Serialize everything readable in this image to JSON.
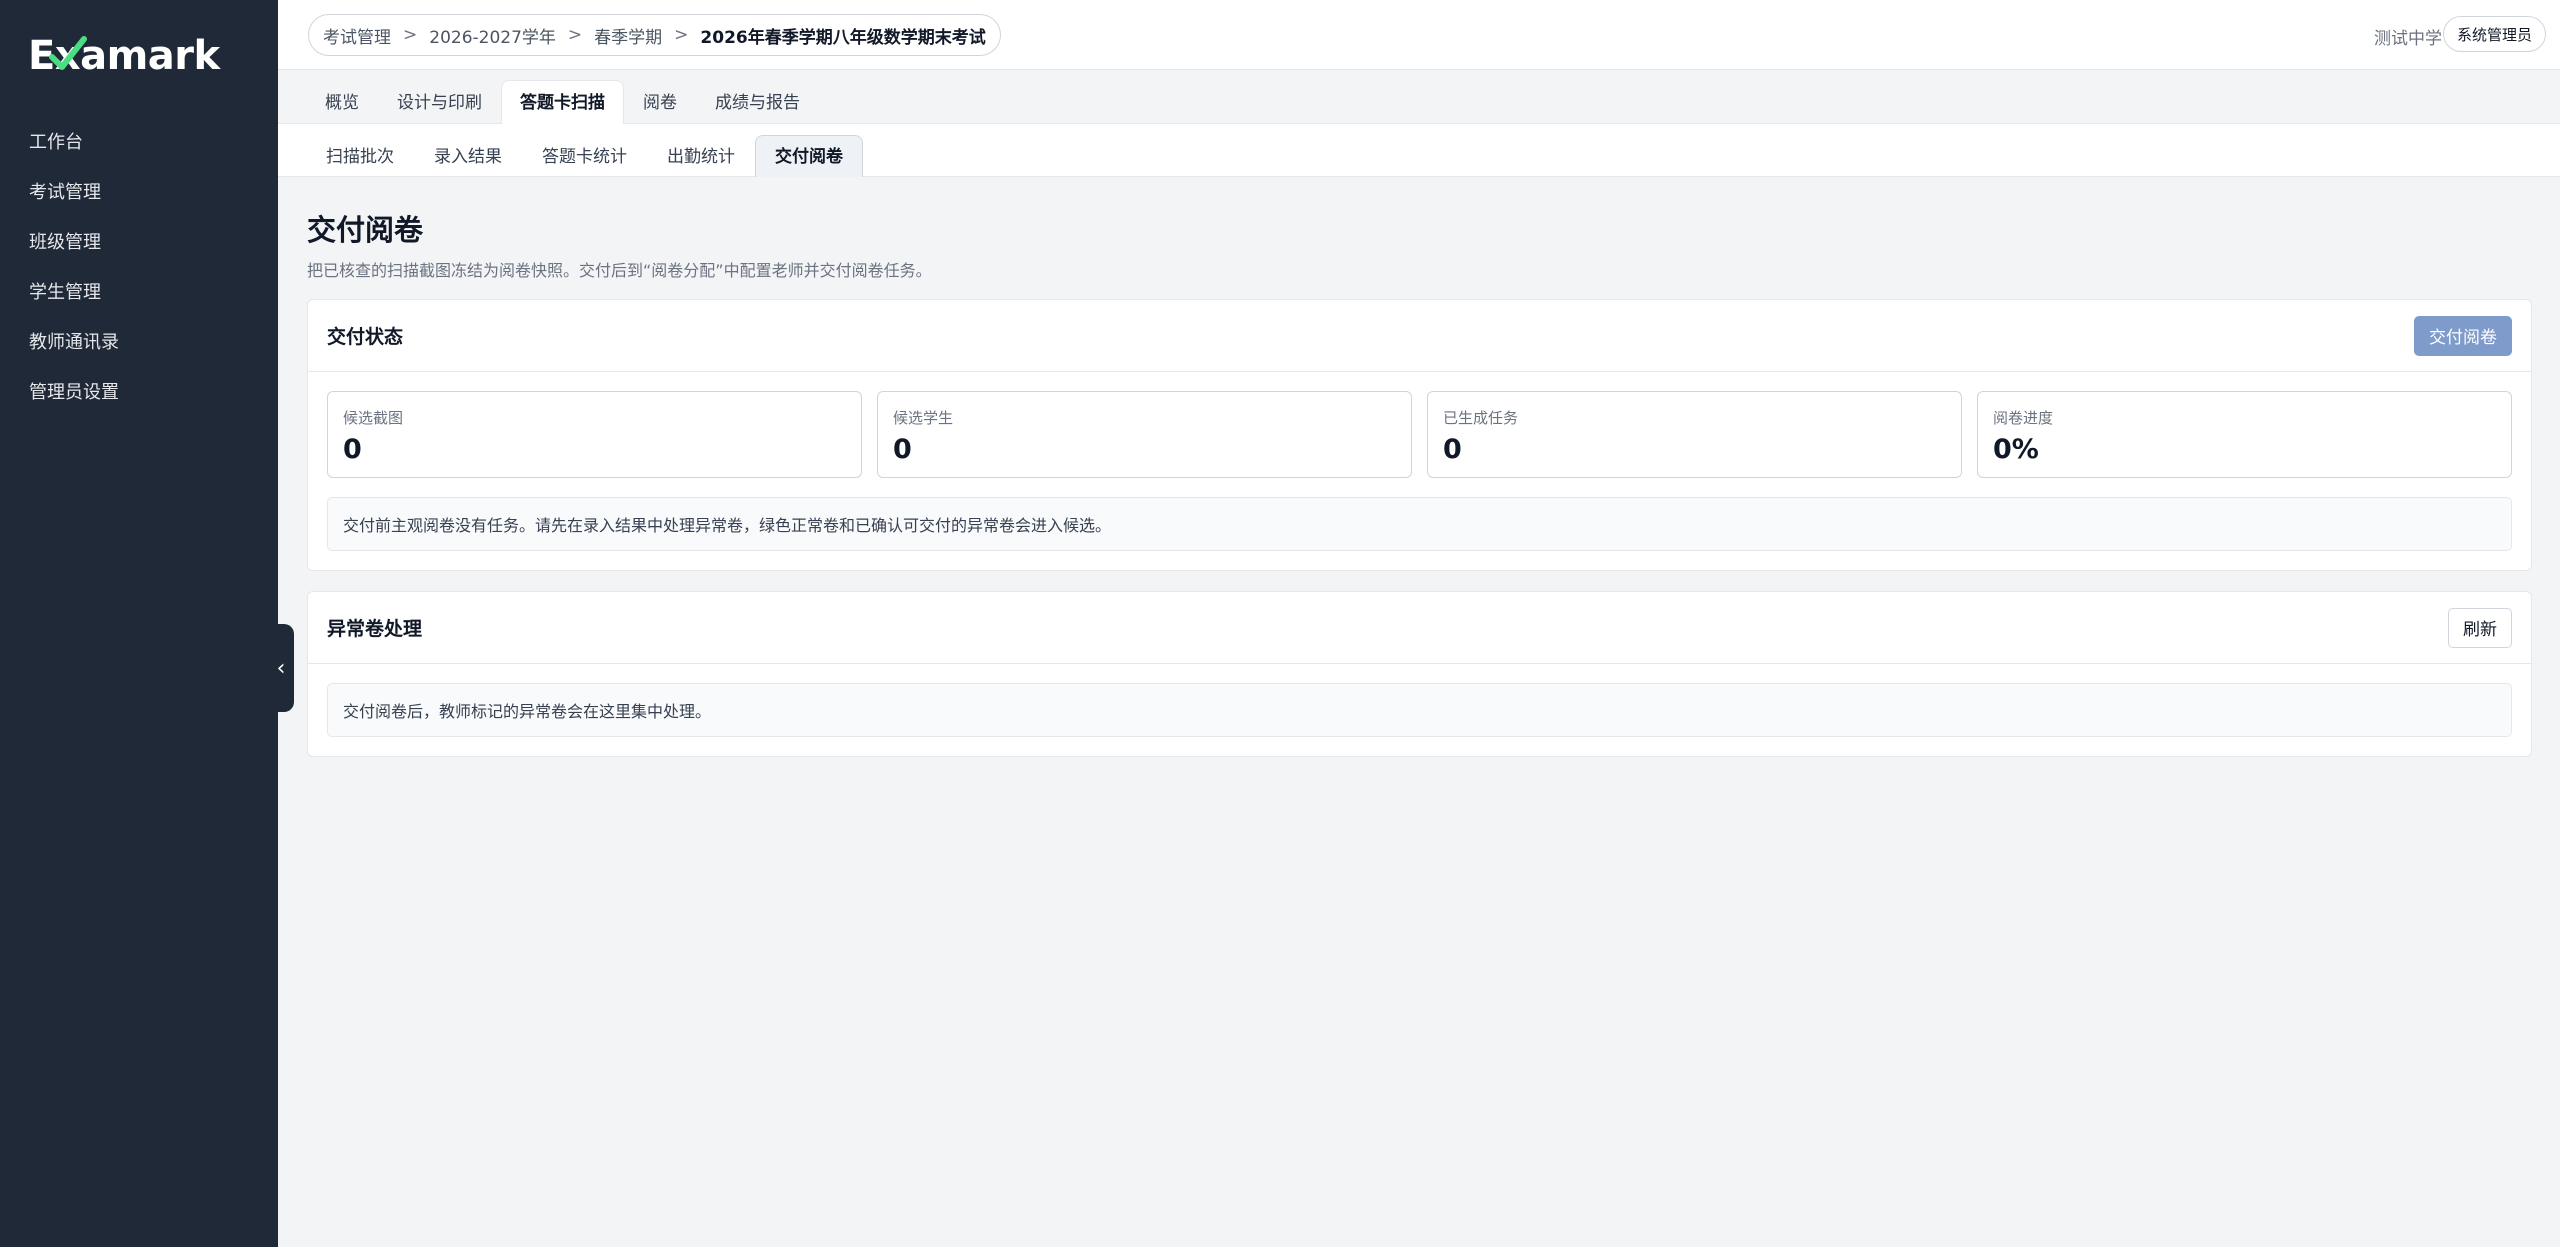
{
  "app": {
    "logo_prefix": "E",
    "logo_rest": "xamark"
  },
  "sidebar": {
    "items": [
      {
        "label": "工作台"
      },
      {
        "label": "考试管理"
      },
      {
        "label": "班级管理"
      },
      {
        "label": "学生管理"
      },
      {
        "label": "教师通讯录"
      },
      {
        "label": "管理员设置"
      }
    ],
    "collapse_glyph": "‹"
  },
  "header": {
    "breadcrumb": [
      "考试管理",
      "2026-2027学年",
      "春季学期",
      "2026年春季学期八年级数学期末考试"
    ],
    "separator": ">",
    "school": "测试中学",
    "role": "系统管理员"
  },
  "tabs": [
    {
      "label": "概览",
      "active": false
    },
    {
      "label": "设计与印刷",
      "active": false
    },
    {
      "label": "答题卡扫描",
      "active": true
    },
    {
      "label": "阅卷",
      "active": false
    },
    {
      "label": "成绩与报告",
      "active": false
    }
  ],
  "subtabs": [
    {
      "label": "扫描批次",
      "active": false
    },
    {
      "label": "录入结果",
      "active": false
    },
    {
      "label": "答题卡统计",
      "active": false
    },
    {
      "label": "出勤统计",
      "active": false
    },
    {
      "label": "交付阅卷",
      "active": true
    }
  ],
  "page": {
    "title": "交付阅卷",
    "description": "把已核查的扫描截图冻结为阅卷快照。交付后到“阅卷分配”中配置老师并交付阅卷任务。"
  },
  "delivery_status": {
    "title": "交付状态",
    "deliver_button": "交付阅卷",
    "stats": [
      {
        "label": "候选截图",
        "value": "0"
      },
      {
        "label": "候选学生",
        "value": "0"
      },
      {
        "label": "已生成任务",
        "value": "0"
      },
      {
        "label": "阅卷进度",
        "value": "0%"
      }
    ],
    "note": "交付前主观阅卷没有任务。请先在录入结果中处理异常卷，绿色正常卷和已确认可交付的异常卷会进入候选。"
  },
  "anomaly": {
    "title": "异常卷处理",
    "refresh_button": "刷新",
    "note": "交付阅卷后，教师标记的异常卷会在这里集中处理。"
  },
  "colors": {
    "sidebar_bg": "#1f2937",
    "page_bg": "#f3f4f6",
    "primary_button": "#7f9bcb",
    "logo_check": "#4ade80"
  }
}
